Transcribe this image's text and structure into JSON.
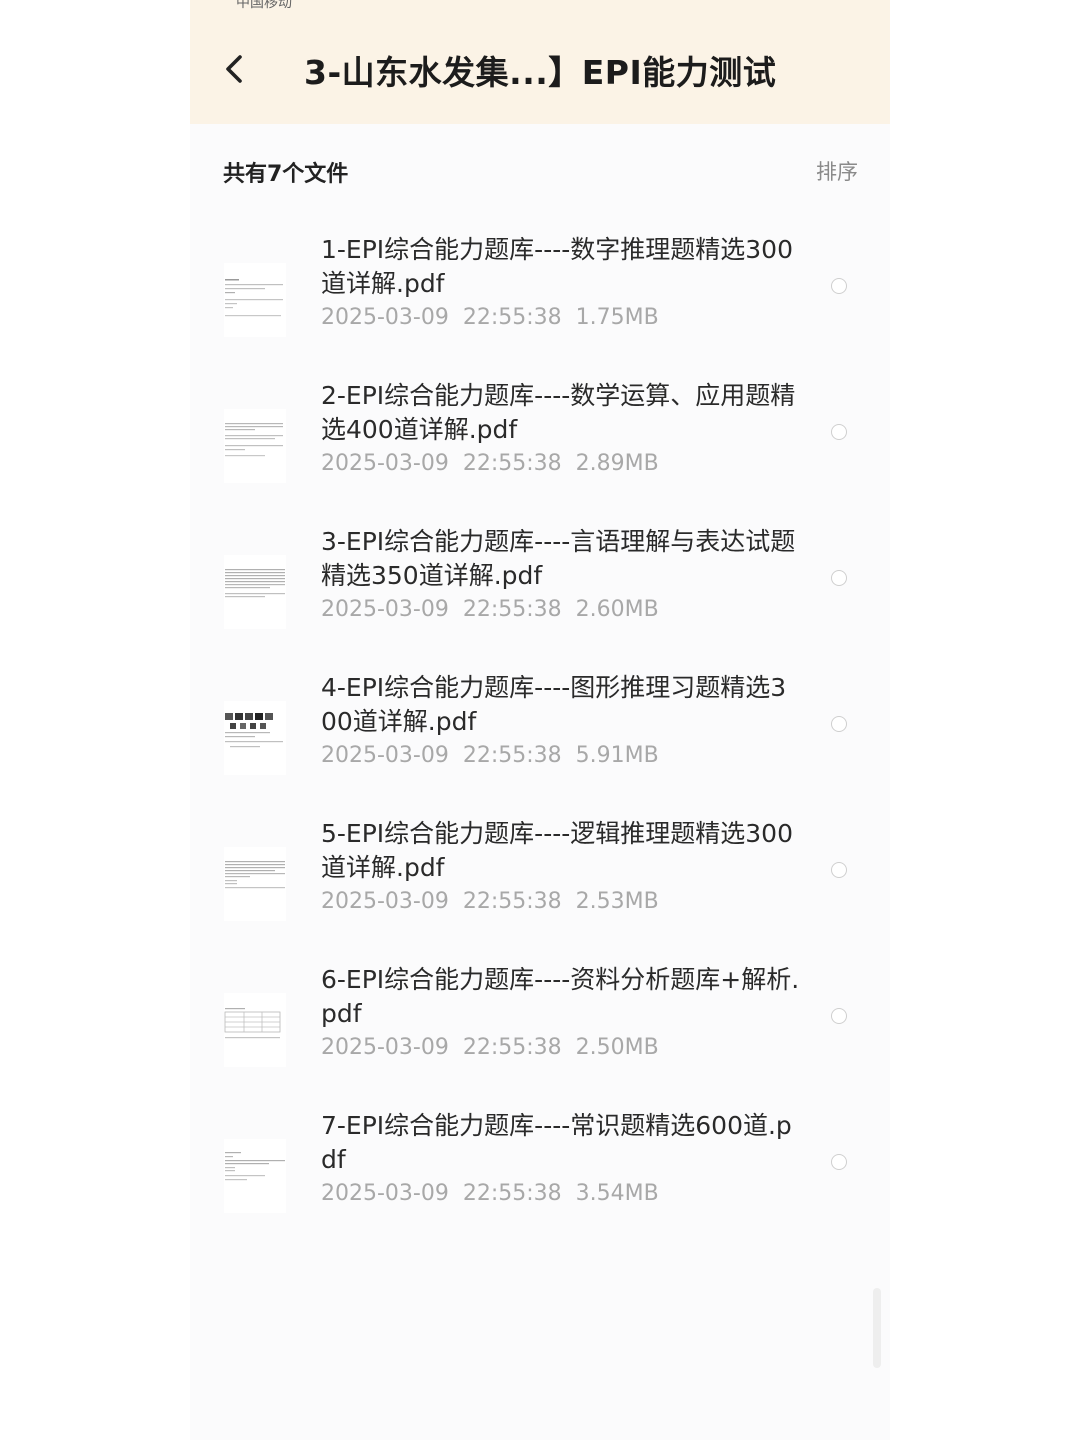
{
  "status_bar": {
    "carrier": "中国移动"
  },
  "header": {
    "title": "3-山东水发集...】EPI能力测试"
  },
  "list_header": {
    "count_text": "共有7个文件",
    "sort_label": "排序"
  },
  "files": [
    {
      "name": "1-EPI综合能力题库----数字推理题精选300道详解.pdf",
      "meta": "2025-03-09  22:55:38  1.75MB"
    },
    {
      "name": "2-EPI综合能力题库----数学运算、应用题精选400道详解.pdf",
      "meta": "2025-03-09  22:55:38  2.89MB"
    },
    {
      "name": "3-EPI综合能力题库----言语理解与表达试题精选350道详解.pdf",
      "meta": "2025-03-09  22:55:38  2.60MB"
    },
    {
      "name": "4-EPI综合能力题库----图形推理习题精选300道详解.pdf",
      "meta": "2025-03-09  22:55:38  5.91MB"
    },
    {
      "name": "5-EPI综合能力题库----逻辑推理题精选300道详解.pdf",
      "meta": "2025-03-09  22:55:38  2.53MB"
    },
    {
      "name": "6-EPI综合能力题库----资料分析题库+解析.pdf",
      "meta": "2025-03-09  22:55:38  2.50MB"
    },
    {
      "name": "7-EPI综合能力题库----常识题精选600道.pdf",
      "meta": "2025-03-09  22:55:38  3.54MB"
    }
  ],
  "colors": {
    "header_bg": "#fbf3e6",
    "title_text": "#1c1c1c",
    "meta_text": "#a8a8a8",
    "sort_text": "#8a8a8a"
  }
}
